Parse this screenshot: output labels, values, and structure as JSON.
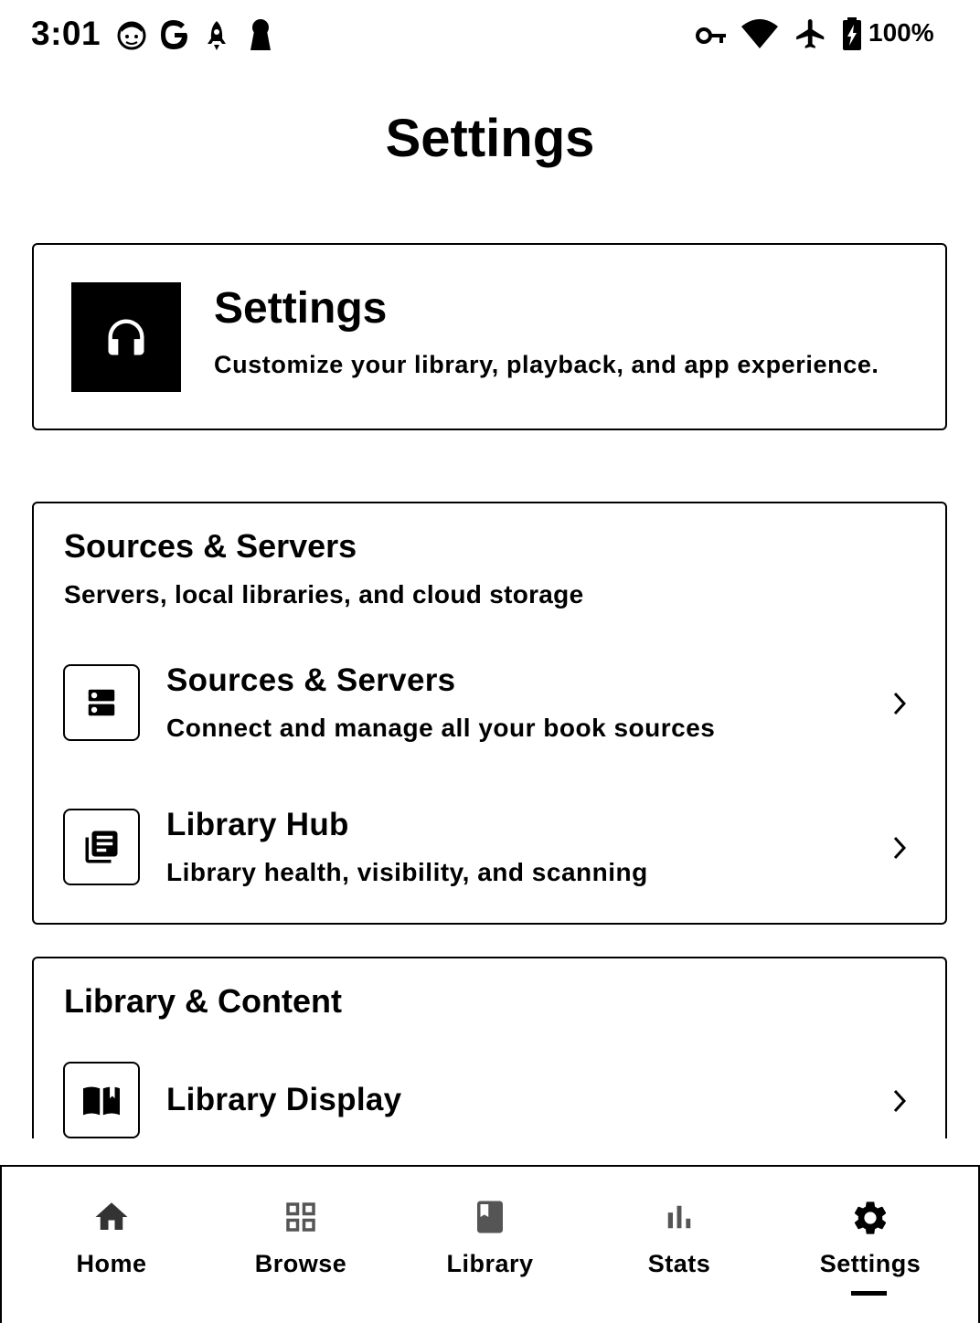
{
  "status_bar": {
    "time": "3:01",
    "battery_percent": "100%",
    "icons": [
      "face-icon",
      "google-icon",
      "rocket-icon",
      "keyhole-icon",
      "vpn-key-icon",
      "wifi-icon",
      "airplane-icon",
      "battery-charging-icon"
    ]
  },
  "page": {
    "title": "Settings"
  },
  "hero": {
    "icon": "headphones-icon",
    "title": "Settings",
    "subtitle": "Customize your library, playback, and app experience."
  },
  "sections": [
    {
      "title": "Sources & Servers",
      "subtitle": "Servers, local libraries, and cloud storage",
      "items": [
        {
          "icon": "server-icon",
          "title": "Sources & Servers",
          "subtitle": "Connect and manage all your book sources"
        },
        {
          "icon": "library-books-icon",
          "title": "Library Hub",
          "subtitle": "Library health, visibility, and scanning"
        }
      ]
    },
    {
      "title": "Library & Content",
      "items": [
        {
          "icon": "open-book-icon",
          "title": "Library Display"
        }
      ]
    }
  ],
  "bottom_nav": {
    "items": [
      {
        "label": "Home",
        "icon": "home-icon"
      },
      {
        "label": "Browse",
        "icon": "grid-icon"
      },
      {
        "label": "Library",
        "icon": "book-icon"
      },
      {
        "label": "Stats",
        "icon": "bar-chart-icon"
      },
      {
        "label": "Settings",
        "icon": "gear-icon"
      }
    ],
    "active": "Settings"
  }
}
